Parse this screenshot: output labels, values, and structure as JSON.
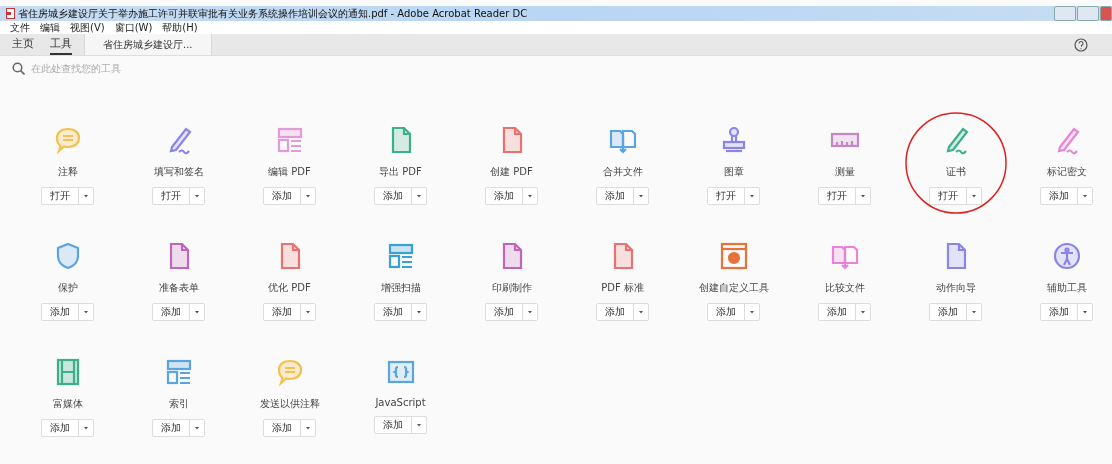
{
  "window": {
    "title": "省住房城乡建设厅关于举办施工许可并联审批有关业务系统操作培训会议的通知.pdf - Adobe Acrobat Reader DC"
  },
  "menu": [
    "文件",
    "编辑",
    "视图(V)",
    "窗口(W)",
    "帮助(H)"
  ],
  "tabs": [
    {
      "label": "主页",
      "selected": false
    },
    {
      "label": "工具",
      "selected": true
    }
  ],
  "document_tab": {
    "label": "省住房城乡建设厅..."
  },
  "search": {
    "placeholder": "在此处查找您的工具"
  },
  "tools": [
    {
      "name": "注释",
      "action": "打开",
      "kind": "bubble",
      "color": "#f2c14e",
      "highlighted": false
    },
    {
      "name": "填写和签名",
      "action": "打开",
      "kind": "pen",
      "color": "#8a84e6",
      "highlighted": false
    },
    {
      "name": "编辑 PDF",
      "action": "添加",
      "kind": "layout",
      "color": "#e39ad6",
      "highlighted": false
    },
    {
      "name": "导出 PDF",
      "action": "添加",
      "kind": "page",
      "color": "#3bb08a",
      "highlighted": false
    },
    {
      "name": "创建 PDF",
      "action": "添加",
      "kind": "page",
      "color": "#e8726f",
      "highlighted": false
    },
    {
      "name": "合并文件",
      "action": "添加",
      "kind": "pages",
      "color": "#5aa5e0",
      "highlighted": false
    },
    {
      "name": "图章",
      "action": "打开",
      "kind": "stamp",
      "color": "#8a84e6",
      "highlighted": false
    },
    {
      "name": "测量",
      "action": "打开",
      "kind": "ruler",
      "color": "#c489c4",
      "highlighted": false
    },
    {
      "name": "证书",
      "action": "打开",
      "kind": "pen",
      "color": "#3bb08a",
      "highlighted": true
    },
    {
      "name": "标记密文",
      "action": "添加",
      "kind": "pen",
      "color": "#e884d8",
      "highlighted": false
    },
    {
      "name": "保护",
      "action": "添加",
      "kind": "shield",
      "color": "#5aa5e0",
      "highlighted": false
    },
    {
      "name": "准备表单",
      "action": "添加",
      "kind": "page",
      "color": "#c066b8",
      "highlighted": false
    },
    {
      "name": "优化 PDF",
      "action": "添加",
      "kind": "page",
      "color": "#e8726f",
      "highlighted": false
    },
    {
      "name": "增强扫描",
      "action": "添加",
      "kind": "layout",
      "color": "#3aa0d8",
      "highlighted": false
    },
    {
      "name": "印刷制作",
      "action": "添加",
      "kind": "page",
      "color": "#c066b8",
      "highlighted": false
    },
    {
      "name": "PDF 标准",
      "action": "添加",
      "kind": "page",
      "color": "#e8726f",
      "highlighted": false
    },
    {
      "name": "创建自定义工具",
      "action": "添加",
      "kind": "gearbox",
      "color": "#e8723a",
      "highlighted": false
    },
    {
      "name": "比较文件",
      "action": "添加",
      "kind": "pages",
      "color": "#e884d8",
      "highlighted": false
    },
    {
      "name": "动作向导",
      "action": "添加",
      "kind": "page",
      "color": "#8a84e6",
      "highlighted": false
    },
    {
      "name": "辅助工具",
      "action": "添加",
      "kind": "person",
      "color": "#8a84e6",
      "highlighted": false
    },
    {
      "name": "富媒体",
      "action": "添加",
      "kind": "film",
      "color": "#3bb08a",
      "highlighted": false
    },
    {
      "name": "索引",
      "action": "添加",
      "kind": "layout",
      "color": "#5aa5e0",
      "highlighted": false
    },
    {
      "name": "发送以供注释",
      "action": "添加",
      "kind": "bubble",
      "color": "#f2c14e",
      "highlighted": false
    },
    {
      "name": "JavaScript",
      "action": "添加",
      "kind": "braces",
      "color": "#5aa5e0",
      "highlighted": false
    }
  ]
}
